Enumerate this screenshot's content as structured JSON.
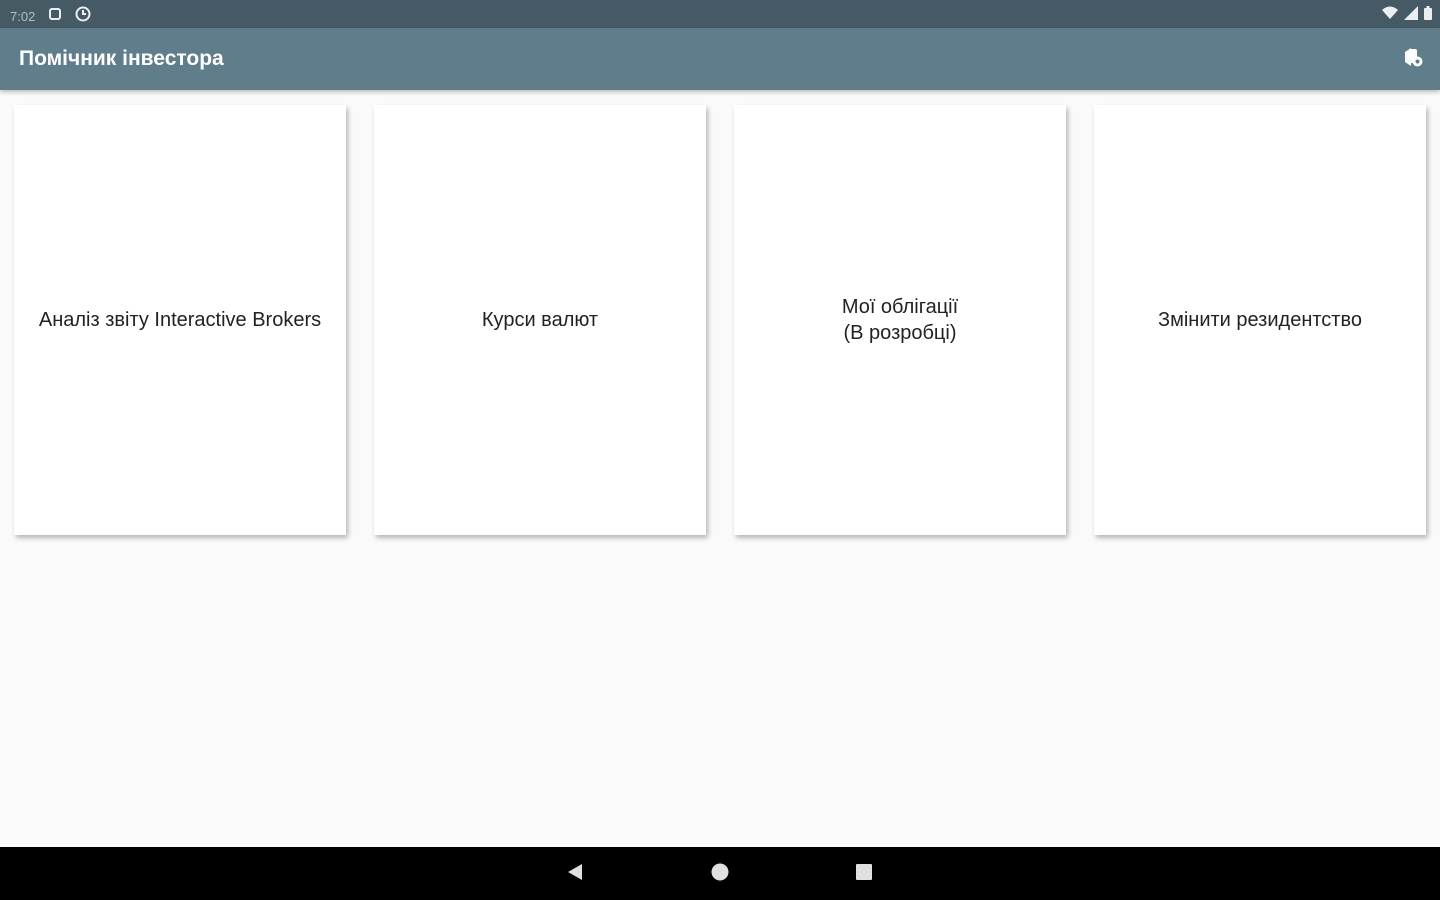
{
  "status_bar": {
    "time": "7:02",
    "icons": [
      "notification-icon",
      "sync-icon",
      "wifi-icon",
      "signal-icon",
      "battery-icon"
    ]
  },
  "app_bar": {
    "title": "Помічник інвестора",
    "action_icon": "settings-icon"
  },
  "cards": [
    {
      "label": "Аналіз звіту Interactive Brokers"
    },
    {
      "label": "Курси валют"
    },
    {
      "label": "Мої облігації\n(В розробці)"
    },
    {
      "label": "Змінити резидентство"
    }
  ],
  "nav_bar": {
    "icons": [
      "back-icon",
      "home-icon",
      "recents-icon"
    ]
  },
  "colors": {
    "status_bar": "#455a64",
    "app_bar": "#607d8b",
    "background": "#fafafa",
    "card": "#ffffff",
    "nav_bar": "#000000"
  }
}
